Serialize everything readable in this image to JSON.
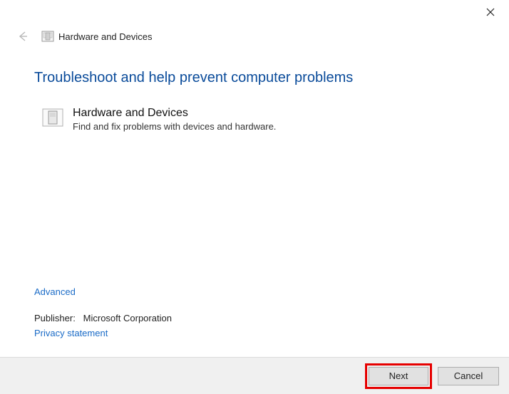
{
  "header": {
    "title": "Hardware and Devices"
  },
  "main": {
    "heading": "Troubleshoot and help prevent computer problems",
    "item": {
      "title": "Hardware and Devices",
      "description": "Find and fix problems with devices and hardware."
    }
  },
  "links": {
    "advanced": "Advanced",
    "publisher_label": "Publisher:",
    "publisher_value": "Microsoft Corporation",
    "privacy": "Privacy statement"
  },
  "footer": {
    "next": "Next",
    "cancel": "Cancel"
  }
}
